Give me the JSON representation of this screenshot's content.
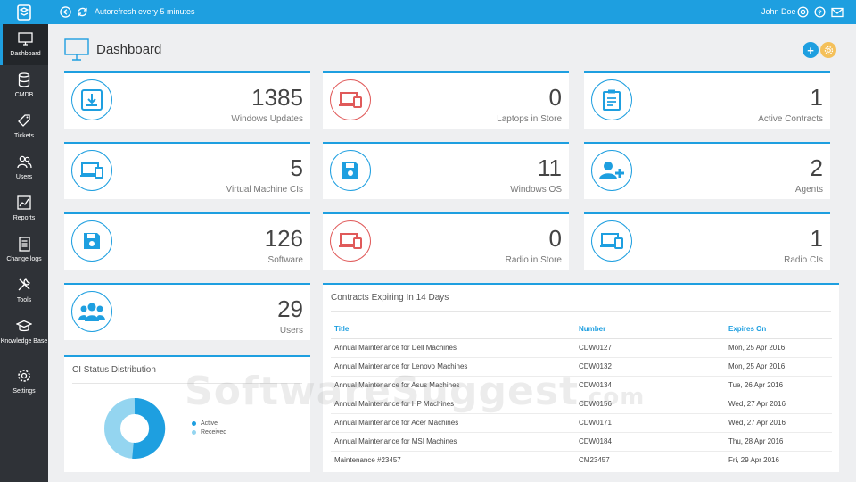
{
  "topbar": {
    "autorefresh": "Autorefresh every 5 minutes",
    "user": "John Doe",
    "color": "#1e9fe0"
  },
  "sidebar": {
    "items": [
      {
        "label": "Dashboard",
        "icon": "monitor-icon"
      },
      {
        "label": "CMDB",
        "icon": "database-icon"
      },
      {
        "label": "Tickets",
        "icon": "tag-icon"
      },
      {
        "label": "Users",
        "icon": "users-icon"
      },
      {
        "label": "Reports",
        "icon": "chart-icon"
      },
      {
        "label": "Change logs",
        "icon": "log-icon"
      },
      {
        "label": "Tools",
        "icon": "tools-icon"
      },
      {
        "label": "Knowledge Base",
        "icon": "graduation-cap-icon"
      },
      {
        "label": "Settings",
        "icon": "gear-icon"
      }
    ]
  },
  "header": {
    "title": "Dashboard"
  },
  "cards": [
    {
      "value": "1385",
      "label": "Windows Updates",
      "icon": "download-icon"
    },
    {
      "value": "0",
      "label": "Laptops in Store",
      "icon": "devices-icon"
    },
    {
      "value": "1",
      "label": "Active Contracts",
      "icon": "clipboard-icon"
    },
    {
      "value": "5",
      "label": "Virtual Machine CIs",
      "icon": "devices-icon"
    },
    {
      "value": "11",
      "label": "Windows OS",
      "icon": "floppy-icon"
    },
    {
      "value": "2",
      "label": "Agents",
      "icon": "add-user-icon"
    },
    {
      "value": "126",
      "label": "Software",
      "icon": "floppy-icon"
    },
    {
      "value": "0",
      "label": "Radio in Store",
      "icon": "devices-icon"
    },
    {
      "value": "1",
      "label": "Radio CIs",
      "icon": "devices-icon"
    },
    {
      "value": "29",
      "label": "Users",
      "icon": "users-icon"
    }
  ],
  "ci_status": {
    "title": "CI Status Distribution",
    "legend": [
      "Active",
      "Received"
    ],
    "colors": [
      "#1e9fe0",
      "#94d5f0"
    ]
  },
  "contracts": {
    "title": "Contracts Expiring In 14 Days",
    "columns": [
      "Title",
      "Number",
      "Expires On"
    ],
    "rows": [
      [
        "Annual Maintenance for Dell Machines",
        "CDW0127",
        "Mon, 25 Apr 2016"
      ],
      [
        "Annual Maintenance for Lenovo Machines",
        "CDW0132",
        "Mon, 25 Apr 2016"
      ],
      [
        "Annual Maintenance for Asus Machines",
        "CDW0134",
        "Tue, 26 Apr 2016"
      ],
      [
        "Annual Maintenance for HP Machines",
        "CDW0156",
        "Wed, 27 Apr 2016"
      ],
      [
        "Annual Maintenance for Acer Machines",
        "CDW0171",
        "Wed, 27 Apr 2016"
      ],
      [
        "Annual Maintenance for MSI Machines",
        "CDW0184",
        "Thu, 28 Apr 2016"
      ],
      [
        "Maintenance #23457",
        "CM23457",
        "Fri, 29 Apr 2016"
      ]
    ]
  },
  "watermark": {
    "main": "SoftwareSuggest",
    "suffix": ".com"
  }
}
